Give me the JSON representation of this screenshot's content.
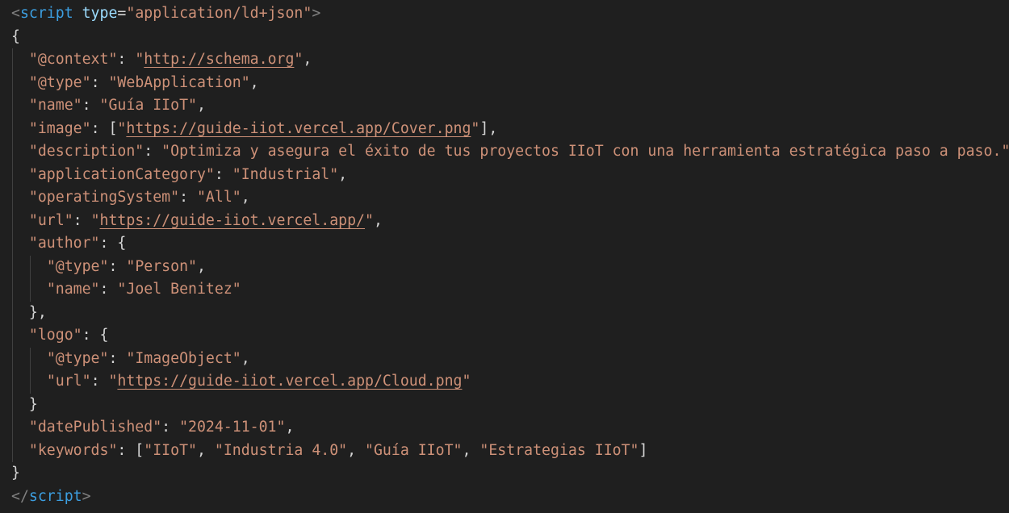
{
  "editor": {
    "script_open": {
      "lt": "<",
      "tag": "script",
      "attr": "type",
      "eq": "=",
      "value": "\"application/ld+json\"",
      "gt": ">"
    },
    "script_close": {
      "lt": "</",
      "tag": "script",
      "gt": ">"
    },
    "lines": [
      {
        "indent": "",
        "parts": [
          "{"
        ]
      },
      {
        "indent": "  ",
        "key": "\"@context\"",
        "sep": ": ",
        "pre": "\"",
        "link": "http://schema.org",
        "post": "\"",
        "tail": ","
      },
      {
        "indent": "  ",
        "key": "\"@type\"",
        "sep": ": ",
        "value": "\"WebApplication\"",
        "tail": ","
      },
      {
        "indent": "  ",
        "key": "\"name\"",
        "sep": ": ",
        "value": "\"Guía IIoT\"",
        "tail": ","
      },
      {
        "indent": "  ",
        "key": "\"image\"",
        "sep": ": [",
        "pre": "\"",
        "link": "https://guide-iiot.vercel.app/Cover.png",
        "post": "\"",
        "tail": "],"
      },
      {
        "indent": "  ",
        "key": "\"description\"",
        "sep": ": ",
        "value": "\"Optimiza y asegura el éxito de tus proyectos IIoT con una herramienta estratégica paso a paso.\"",
        "tail": ","
      },
      {
        "indent": "  ",
        "key": "\"applicationCategory\"",
        "sep": ": ",
        "value": "\"Industrial\"",
        "tail": ","
      },
      {
        "indent": "  ",
        "key": "\"operatingSystem\"",
        "sep": ": ",
        "value": "\"All\"",
        "tail": ","
      },
      {
        "indent": "  ",
        "key": "\"url\"",
        "sep": ": ",
        "pre": "\"",
        "link": "https://guide-iiot.vercel.app/",
        "post": "\"",
        "tail": ","
      },
      {
        "indent": "  ",
        "key": "\"author\"",
        "sep": ": {",
        "tail": ""
      },
      {
        "indent": "    ",
        "key": "\"@type\"",
        "sep": ": ",
        "value": "\"Person\"",
        "tail": ","
      },
      {
        "indent": "    ",
        "key": "\"name\"",
        "sep": ": ",
        "value": "\"Joel Benitez\"",
        "tail": ""
      },
      {
        "indent": "  ",
        "parts": [
          "},"
        ]
      },
      {
        "indent": "  ",
        "key": "\"logo\"",
        "sep": ": {",
        "tail": ""
      },
      {
        "indent": "    ",
        "key": "\"@type\"",
        "sep": ": ",
        "value": "\"ImageObject\"",
        "tail": ","
      },
      {
        "indent": "    ",
        "key": "\"url\"",
        "sep": ": ",
        "pre": "\"",
        "link": "https://guide-iiot.vercel.app/Cloud.png",
        "post": "\"",
        "tail": ""
      },
      {
        "indent": "  ",
        "parts": [
          "}"
        ]
      },
      {
        "indent": "  ",
        "key": "\"datePublished\"",
        "sep": ": ",
        "value": "\"2024-11-01\"",
        "tail": ","
      },
      {
        "indent": "  ",
        "key": "\"keywords\"",
        "sep": ": [",
        "list": [
          "\"IIoT\"",
          "\"Industria 4.0\"",
          "\"Guía IIoT\"",
          "\"Estrategias IIoT\""
        ],
        "tail": "]"
      },
      {
        "indent": "",
        "parts": [
          "}"
        ]
      }
    ]
  },
  "colors": {
    "background": "#1f1f1f",
    "tag": "#3c9ee0",
    "attribute": "#9cdcfe",
    "string": "#ce9178",
    "punctuation": "#d4d4d4",
    "bracket": "#808080"
  }
}
